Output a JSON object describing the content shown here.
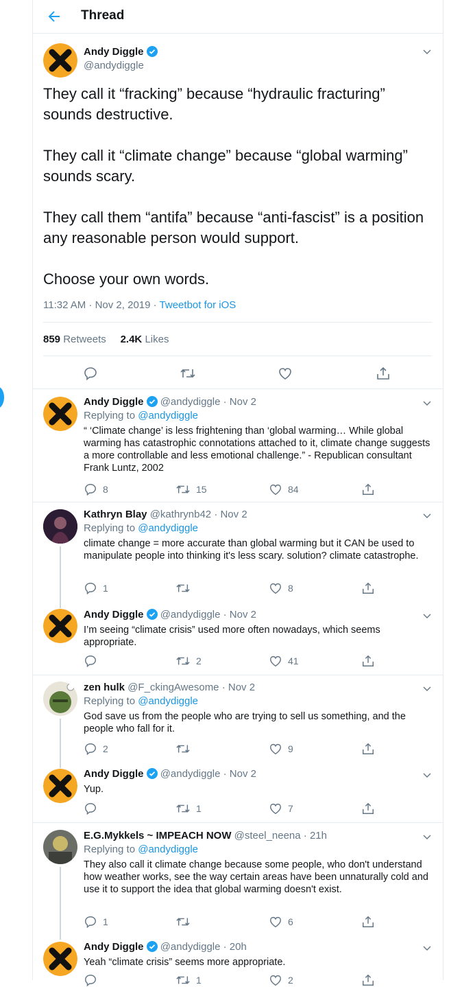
{
  "header": {
    "title": "Thread"
  },
  "main_tweet": {
    "name": "Andy Diggle",
    "handle": "@andydiggle",
    "text": "They call it “fracking” because “hydraulic fracturing” sounds destructive.\n\nThey call it “climate change” because “global warming” sounds scary.\n\nThey call them “antifa” because “anti-fascist” is a position any reasonable person would support.\n\nChoose your own words.",
    "time": "11:32 AM · Nov 2, 2019 · ",
    "source": "Tweetbot for iOS",
    "retweets": "859",
    "retweets_label": "Retweets",
    "likes": "2.4K",
    "likes_label": "Likes"
  },
  "replies": [
    {
      "name": "Andy Diggle",
      "handle": "@andydiggle · Nov 2",
      "replying_prefix": "Replying to ",
      "replying_to": "@andydiggle",
      "text": "“ ‘Climate change’ is less frightening than ‘global warming… While global warming has catastrophic connotations attached to it, climate change suggests a more controllable and less emotional challenge.” - Republican consultant Frank Luntz, 2002",
      "replies": "8",
      "retweets": "15",
      "likes": "84"
    },
    {
      "name": "Kathryn Blay",
      "handle": "@kathrynb42 · Nov 2",
      "replying_prefix": "Replying to ",
      "replying_to": "@andydiggle",
      "text": "climate change = more accurate than global warming but it CAN be used to manipulate people into thinking it's less scary. solution? climate catastrophe.",
      "replies": "1",
      "retweets": "",
      "likes": "8"
    },
    {
      "name": "Andy Diggle",
      "handle": "@andydiggle · Nov 2",
      "text": "I’m seeing “climate crisis” used more often nowadays, which seems appropriate.",
      "replies": "",
      "retweets": "2",
      "likes": "41"
    },
    {
      "name": "zen hulk",
      "handle": "@F_ckingAwesome · Nov 2",
      "replying_prefix": "Replying to ",
      "replying_to": "@andydiggle",
      "text": "God save us from the people who are trying to sell us something, and the people who fall for it.",
      "replies": "2",
      "retweets": "",
      "likes": "9"
    },
    {
      "name": "Andy Diggle",
      "handle": "@andydiggle · Nov 2",
      "text": "Yup.",
      "replies": "",
      "retweets": "1",
      "likes": "7"
    },
    {
      "name": "E.G.Mykkels ~ IMPEACH NOW",
      "handle": "@steel_neena · 21h",
      "replying_prefix": "Replying to ",
      "replying_to": "@andydiggle",
      "text": "They also call it climate change because some people, who don't understand how weather works, see the way certain areas have been unnaturally cold and use it to support the idea that global warming doesn't exist.",
      "replies": "1",
      "retweets": "",
      "likes": "6"
    },
    {
      "name": "Andy Diggle",
      "handle": "@andydiggle · 20h",
      "text": "Yeah “climate crisis” seems more appropriate.",
      "replies": "",
      "retweets": "1",
      "likes": "2"
    }
  ],
  "colors": {
    "accent": "#1da1f2",
    "link": "#1b95e0",
    "muted": "#657786"
  }
}
